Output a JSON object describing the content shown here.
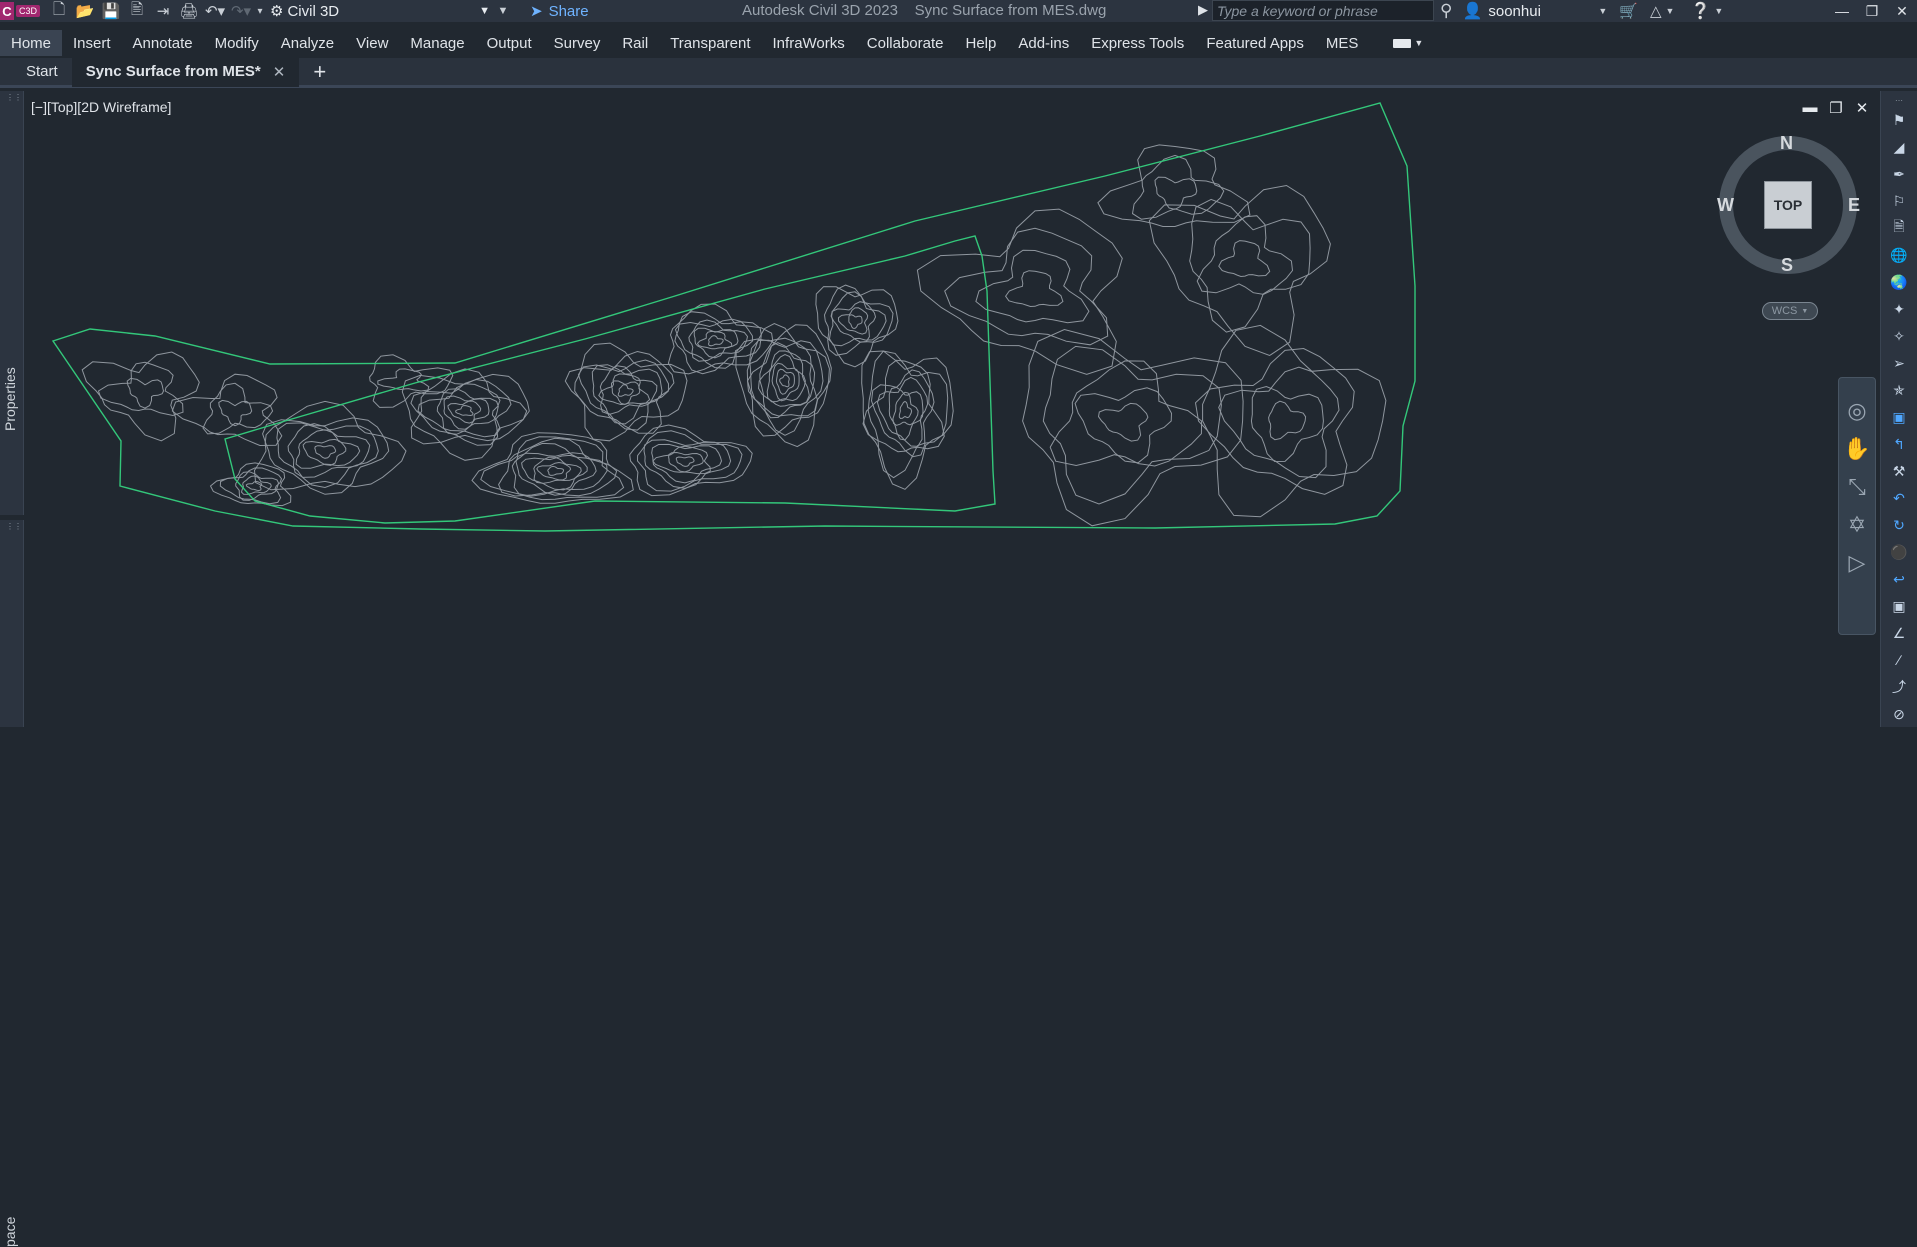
{
  "titlebar": {
    "app_badge_letter": "C",
    "app_badge_text": "C3D",
    "workspace": "Civil 3D",
    "share_label": "Share",
    "app_title": "Autodesk Civil 3D 2023",
    "file_name": "Sync Surface from MES.dwg",
    "search_placeholder": "Type a keyword or phrase",
    "user_name": "soonhui"
  },
  "menu": {
    "items": [
      "Home",
      "Insert",
      "Annotate",
      "Modify",
      "Analyze",
      "View",
      "Manage",
      "Output",
      "Survey",
      "Rail",
      "Transparent",
      "InfraWorks",
      "Collaborate",
      "Help",
      "Add-ins",
      "Express Tools",
      "Featured Apps",
      "MES"
    ],
    "active_index": 0
  },
  "tabs": {
    "start_label": "Start",
    "active_label": "Sync Surface from MES*"
  },
  "left_palettes": {
    "properties_label": "Properties",
    "space_label": "pace"
  },
  "viewport": {
    "label": "[−][Top][2D Wireframe]",
    "viewcube": {
      "face": "TOP",
      "north": "N",
      "south": "S",
      "east": "E",
      "west": "W",
      "ucs": "WCS"
    },
    "boundary_color": "#33c77a",
    "contour_color": "#8f969e"
  },
  "colors": {
    "background": "#212830",
    "panel": "#2c3440",
    "accent": "#6fb3ff",
    "brand": "#a1276f"
  }
}
